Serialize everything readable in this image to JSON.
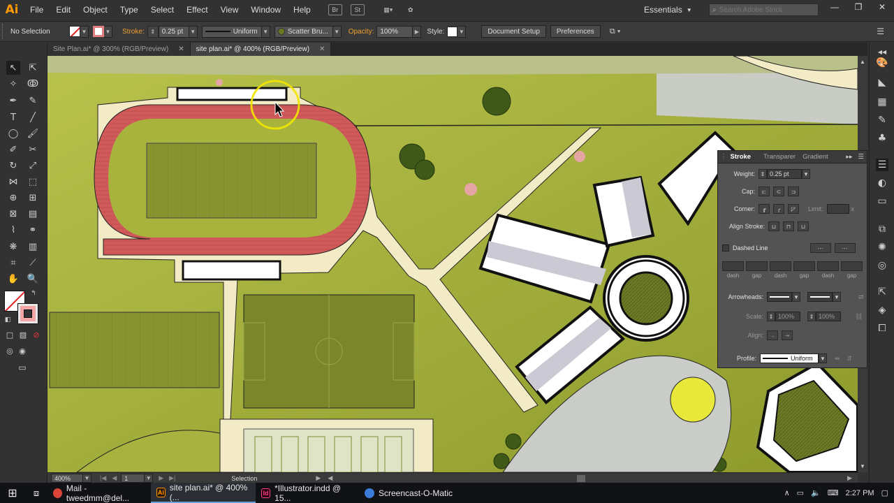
{
  "app": {
    "logo": "Ai",
    "accent": "#ff9a00"
  },
  "menu": [
    "File",
    "Edit",
    "Object",
    "Type",
    "Select",
    "Effect",
    "View",
    "Window",
    "Help"
  ],
  "menu_icons": [
    "Br",
    "St"
  ],
  "workspace": {
    "label": "Essentials"
  },
  "search": {
    "placeholder": "Search Adobe Stock"
  },
  "control": {
    "selection": "No Selection",
    "stroke_label": "Stroke:",
    "stroke_weight": "0.25 pt",
    "profile": "Uniform",
    "brush": "Scatter Bru...",
    "opacity_label": "Opacity:",
    "opacity": "100%",
    "style_label": "Style:",
    "document_setup": "Document Setup",
    "preferences": "Preferences"
  },
  "tabs": [
    {
      "label": "Site Plan.ai* @ 300% (RGB/Preview)",
      "active": false
    },
    {
      "label": "site plan.ai* @ 400% (RGB/Preview)",
      "active": true
    }
  ],
  "status": {
    "zoom": "400%",
    "artboard": "1",
    "tool": "Selection"
  },
  "stroke_panel": {
    "tabs": [
      "Stroke",
      "Transparer",
      "Gradient"
    ],
    "weight_label": "Weight:",
    "weight": "0.25 pt",
    "cap_label": "Cap:",
    "corner_label": "Corner:",
    "limit_label": "Limit:",
    "limit_x": "x",
    "align_label": "Align Stroke:",
    "dashed_label": "Dashed Line",
    "dash_labels": [
      "dash",
      "gap",
      "dash",
      "gap",
      "dash",
      "gap"
    ],
    "arrowheads_label": "Arrowheads:",
    "scale_label": "Scale:",
    "scale1": "100%",
    "scale2": "100%",
    "align_arrow_label": "Align:",
    "profile_label": "Profile:",
    "profile": "Uniform"
  },
  "taskbar": {
    "items": [
      {
        "label": "Mail - tweedmm@del...",
        "icon": "chrome-icon"
      },
      {
        "label": "site plan.ai* @ 400% (...",
        "icon": "illustrator-icon"
      },
      {
        "label": "*Illustrator.indd @ 15...",
        "icon": "indesign-icon"
      },
      {
        "label": "Screencast-O-Matic",
        "icon": "screencast-icon"
      }
    ],
    "time": "2:27 PM"
  }
}
